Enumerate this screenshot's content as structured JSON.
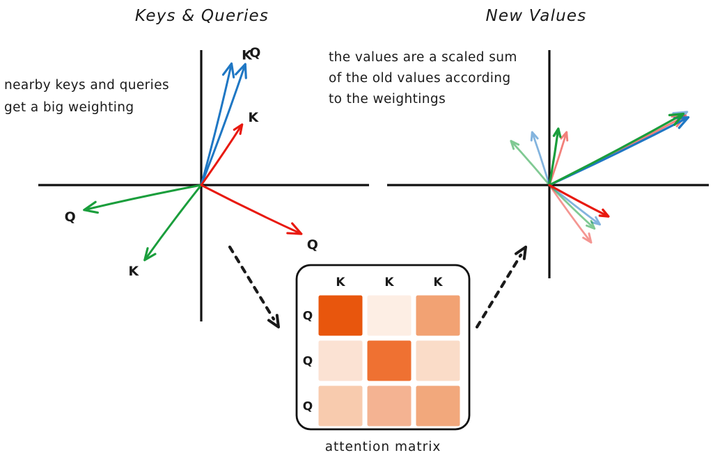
{
  "colors": {
    "blue": "#1f77c4",
    "green": "#1a9e3c",
    "red": "#e8190f",
    "axis": "#111111",
    "ink": "#1a1a1a",
    "matrix_border": "#111111",
    "heat_max": "#e8560d",
    "heat_min": "#fdece2"
  },
  "left_panel": {
    "title": "Keys & Queries",
    "annotation_lines": [
      "nearby keys and queries",
      "get a big weighting"
    ],
    "vectors": [
      {
        "label": "K",
        "color": "blue",
        "angle_deg": 76,
        "length": 180,
        "label_dx": 22,
        "label_dy": -6
      },
      {
        "label": "Q",
        "color": "blue",
        "angle_deg": 70,
        "length": 185,
        "label_dx": 14,
        "label_dy": -10
      },
      {
        "label": "K",
        "color": "red",
        "angle_deg": 56,
        "length": 105,
        "label_dx": 16,
        "label_dy": -4
      },
      {
        "label": "Q",
        "color": "green",
        "angle_deg": 192,
        "length": 172,
        "label_dx": -20,
        "label_dy": 16
      },
      {
        "label": "K",
        "color": "green",
        "angle_deg": 233,
        "length": 135,
        "label_dx": -16,
        "label_dy": 22
      },
      {
        "label": "Q",
        "color": "red",
        "angle_deg": 334,
        "length": 160,
        "label_dx": 16,
        "label_dy": 22
      }
    ]
  },
  "right_panel": {
    "title": "New Values",
    "annotation_lines": [
      "the values are a scaled sum",
      "of the old values according",
      "to the weightings"
    ],
    "vectors": [
      {
        "color": "blue",
        "opacity": 1.0,
        "angle_deg": 26,
        "length": 222
      },
      {
        "color": "blue",
        "opacity": 0.55,
        "angle_deg": 28,
        "length": 224
      },
      {
        "color": "green",
        "opacity": 1.0,
        "angle_deg": 28,
        "length": 218
      },
      {
        "color": "red",
        "opacity": 0.55,
        "angle_deg": 27,
        "length": 220
      },
      {
        "color": "green",
        "opacity": 1.0,
        "angle_deg": 81,
        "length": 82
      },
      {
        "color": "blue",
        "opacity": 0.55,
        "angle_deg": 108,
        "length": 80
      },
      {
        "color": "red",
        "opacity": 0.55,
        "angle_deg": 72,
        "length": 80
      },
      {
        "color": "green",
        "opacity": 0.55,
        "angle_deg": 131,
        "length": 84
      },
      {
        "color": "red",
        "opacity": 1.0,
        "angle_deg": -28,
        "length": 96
      },
      {
        "color": "blue",
        "opacity": 0.55,
        "angle_deg": -38,
        "length": 92
      },
      {
        "color": "green",
        "opacity": 0.55,
        "angle_deg": -44,
        "length": 90
      },
      {
        "color": "red",
        "opacity": 0.45,
        "angle_deg": -54,
        "length": 102
      }
    ]
  },
  "matrix": {
    "caption": "attention matrix",
    "column_headers": [
      {
        "label": "K",
        "color": "blue"
      },
      {
        "label": "K",
        "color": "green"
      },
      {
        "label": "K",
        "color": "red"
      }
    ],
    "row_headers": [
      {
        "label": "Q",
        "color": "blue"
      },
      {
        "label": "Q",
        "color": "green"
      },
      {
        "label": "Q",
        "color": "red"
      }
    ],
    "cells": [
      [
        {
          "fill": "#e8560d",
          "weight": 0.95
        },
        {
          "fill": "#fdeee4",
          "weight": 0.08
        },
        {
          "fill": "#f2a273",
          "weight": 0.48
        }
      ],
      [
        {
          "fill": "#fbe2d3",
          "weight": 0.14
        },
        {
          "fill": "#ef7132",
          "weight": 0.82
        },
        {
          "fill": "#fadcc8",
          "weight": 0.18
        }
      ],
      [
        {
          "fill": "#f8cbae",
          "weight": 0.28
        },
        {
          "fill": "#f4b392",
          "weight": 0.38
        },
        {
          "fill": "#f2a87c",
          "weight": 0.44
        }
      ]
    ]
  },
  "flow_arrows": [
    {
      "name": "left-to-matrix",
      "from": [
        330,
        355
      ],
      "to": [
        400,
        470
      ]
    },
    {
      "name": "matrix-to-right",
      "from": [
        685,
        470
      ],
      "to": [
        755,
        355
      ]
    }
  ]
}
